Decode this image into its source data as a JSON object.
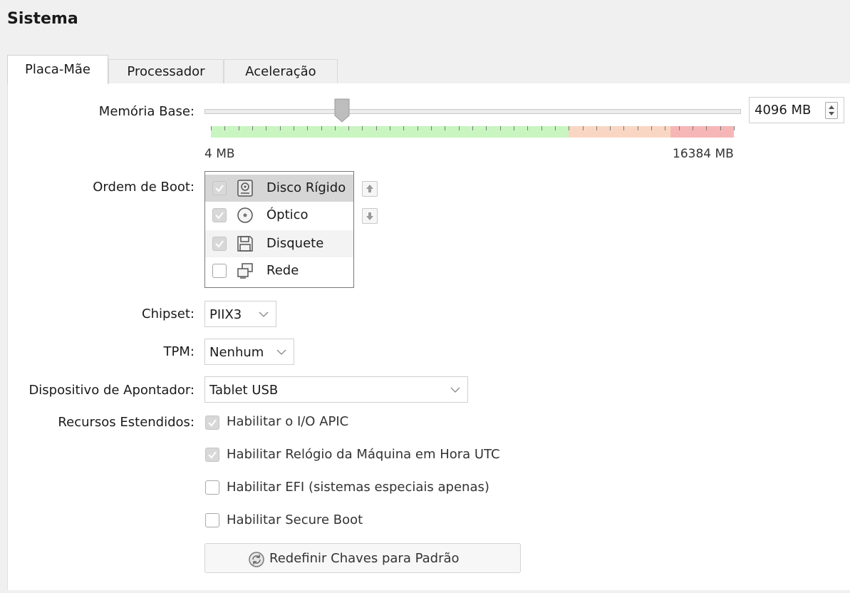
{
  "page_title": "Sistema",
  "tabs": [
    {
      "label": "Placa-Mãe",
      "active": true
    },
    {
      "label": "Processador",
      "active": false
    },
    {
      "label": "Aceleração",
      "active": false
    }
  ],
  "memory": {
    "label": "Memória Base:",
    "value": 4096,
    "value_text": "4096 MB",
    "min_label": "4 MB",
    "max_label": "16384 MB",
    "min": 4,
    "max": 16384,
    "zone_colors": {
      "ok": "#c8f5c0",
      "warn": "#f9d6c4",
      "danger": "#f7b6b6"
    }
  },
  "boot_order": {
    "label": "Ordem de Boot:",
    "items": [
      {
        "label": "Disco Rígido",
        "icon": "hard-disk-icon",
        "checked": true,
        "selected": true
      },
      {
        "label": "Óptico",
        "icon": "optical-disc-icon",
        "checked": true,
        "selected": false
      },
      {
        "label": "Disquete",
        "icon": "floppy-icon",
        "checked": true,
        "selected": false
      },
      {
        "label": "Rede",
        "icon": "network-icon",
        "checked": false,
        "selected": false
      }
    ],
    "move_up_icon": "arrow-up-icon",
    "move_down_icon": "arrow-down-icon"
  },
  "chipset": {
    "label": "Chipset:",
    "value": "PIIX3"
  },
  "tpm": {
    "label": "TPM:",
    "value": "Nenhum"
  },
  "pointing_device": {
    "label": "Dispositivo de Apontador:",
    "value": "Tablet USB"
  },
  "extended": {
    "label": "Recursos Estendidos:",
    "options": [
      {
        "label": "Habilitar o I/O APIC",
        "checked": true
      },
      {
        "label": "Habilitar Relógio da Máquina em Hora UTC",
        "checked": true
      },
      {
        "label": "Habilitar EFI (sistemas especiais apenas)",
        "checked": false
      },
      {
        "label": "Habilitar Secure Boot",
        "checked": false
      }
    ]
  },
  "reset_keys_button": {
    "label": "Redefinir Chaves para Padrão",
    "icon": "reset-icon"
  }
}
